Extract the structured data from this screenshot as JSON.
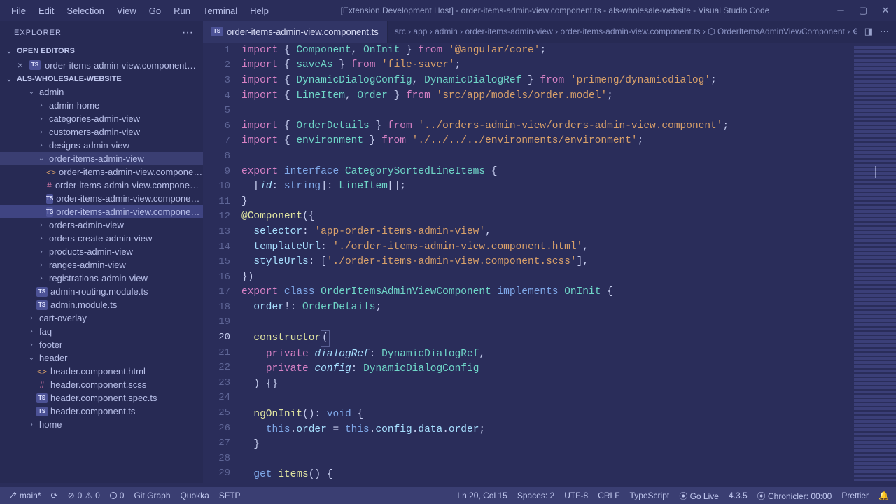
{
  "title": "[Extension Development Host] - order-items-admin-view.component.ts - als-wholesale-website - Visual Studio Code",
  "menu": [
    "File",
    "Edit",
    "Selection",
    "View",
    "Go",
    "Run",
    "Terminal",
    "Help"
  ],
  "sidebar": {
    "explorer_label": "EXPLORER",
    "open_editors_label": "OPEN EDITORS",
    "open_editor_name": "order-items-admin-view.component…",
    "workspace_label": "ALS-WHOLESALE-WEBSITE",
    "tree": [
      {
        "d": 1,
        "type": "folder-open",
        "label": "admin"
      },
      {
        "d": 2,
        "type": "folder",
        "label": "admin-home"
      },
      {
        "d": 2,
        "type": "folder",
        "label": "categories-admin-view"
      },
      {
        "d": 2,
        "type": "folder",
        "label": "customers-admin-view"
      },
      {
        "d": 2,
        "type": "folder",
        "label": "designs-admin-view"
      },
      {
        "d": 2,
        "type": "folder-open",
        "label": "order-items-admin-view",
        "sel": true
      },
      {
        "d": 3,
        "type": "html",
        "label": "order-items-admin-view.compone…",
        "mod": true
      },
      {
        "d": 3,
        "type": "scss",
        "label": "order-items-admin-view.compone…"
      },
      {
        "d": 3,
        "type": "ts",
        "label": "order-items-admin-view.compone…"
      },
      {
        "d": 3,
        "type": "ts",
        "label": "order-items-admin-view.compone…",
        "active": true
      },
      {
        "d": 2,
        "type": "folder",
        "label": "orders-admin-view"
      },
      {
        "d": 2,
        "type": "folder",
        "label": "orders-create-admin-view"
      },
      {
        "d": 2,
        "type": "folder",
        "label": "products-admin-view"
      },
      {
        "d": 2,
        "type": "folder",
        "label": "ranges-admin-view"
      },
      {
        "d": 2,
        "type": "folder",
        "label": "registrations-admin-view"
      },
      {
        "d": 2,
        "type": "ts",
        "label": "admin-routing.module.ts"
      },
      {
        "d": 2,
        "type": "ts",
        "label": "admin.module.ts"
      },
      {
        "d": 1,
        "type": "folder",
        "label": "cart-overlay"
      },
      {
        "d": 1,
        "type": "folder",
        "label": "faq"
      },
      {
        "d": 1,
        "type": "folder",
        "label": "footer"
      },
      {
        "d": 1,
        "type": "folder-open",
        "label": "header"
      },
      {
        "d": 2,
        "type": "html",
        "label": "header.component.html"
      },
      {
        "d": 2,
        "type": "scss",
        "label": "header.component.scss"
      },
      {
        "d": 2,
        "type": "ts",
        "label": "header.component.spec.ts"
      },
      {
        "d": 2,
        "type": "ts",
        "label": "header.component.ts"
      },
      {
        "d": 1,
        "type": "folder",
        "label": "home"
      }
    ]
  },
  "tab": {
    "label": "order-items-admin-view.component.ts"
  },
  "breadcrumb": "src › app › admin › order-items-admin-view › order-items-admin-view.component.ts › ⬡ OrderItemsAdminViewComponent › ⚙ constructor",
  "code_lines": 29,
  "current_line": 20,
  "status": {
    "branch": "main*",
    "sync": "⟳",
    "errors": "0",
    "warnings": "0",
    "port": "0",
    "gitgraph": "Git Graph",
    "quokka": "Quokka",
    "sftp": "SFTP",
    "position": "Ln 20, Col 15",
    "spaces": "Spaces: 2",
    "encoding": "UTF-8",
    "eol": "CRLF",
    "language": "TypeScript",
    "golive": "⦿ Go Live",
    "version": "4.3.5",
    "chronicler": "⦿ Chronicler: 00:00",
    "prettier": "Prettier"
  }
}
